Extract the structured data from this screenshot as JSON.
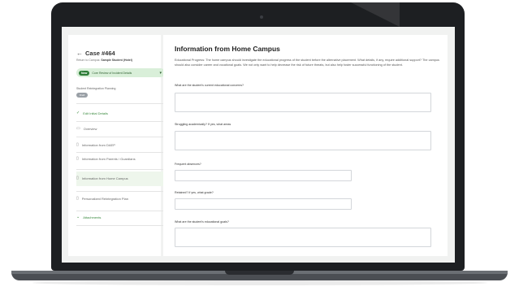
{
  "sidebar": {
    "case_title": "Case #464",
    "subtitle_prefix": "Return to Campus:",
    "subtitle_student": "Sample Student (Hotel)",
    "status_tag": "Now",
    "status_text": "Core Review of Incident Details",
    "meeting_label": "Student Reintegration Planning",
    "meeting_badge": "Draft",
    "nav": [
      {
        "icon": "✓",
        "label": "Edit Initial Details"
      },
      {
        "icon": "▭",
        "label": "Overview"
      },
      {
        "icon": "▯",
        "label": "Information from DAEP"
      },
      {
        "icon": "▯",
        "label": "Information from Parents / Guardians"
      },
      {
        "icon": "▯",
        "label": "Information from Home Campus"
      },
      {
        "icon": "▯",
        "label": "Personalized Reintegration Plan"
      },
      {
        "icon": "⌄",
        "label": "Attachments"
      }
    ]
  },
  "main": {
    "title": "Information from Home Campus",
    "intro": "Educational Progress: The home campus should investigate the educational progress of the student before the alternative placement. What details, if any, require additional support? The campus should also consider career and vocational goals. We not only want to help decrease the risk of future threats, but also help foster successful functioning of the student.",
    "questions": [
      "What are the student's current educational concerns?",
      "Struggling academically? If yes, what areas",
      "Frequent absences?",
      "Retained? If yes, what grade?",
      "What are the student's educational goals?"
    ]
  }
}
